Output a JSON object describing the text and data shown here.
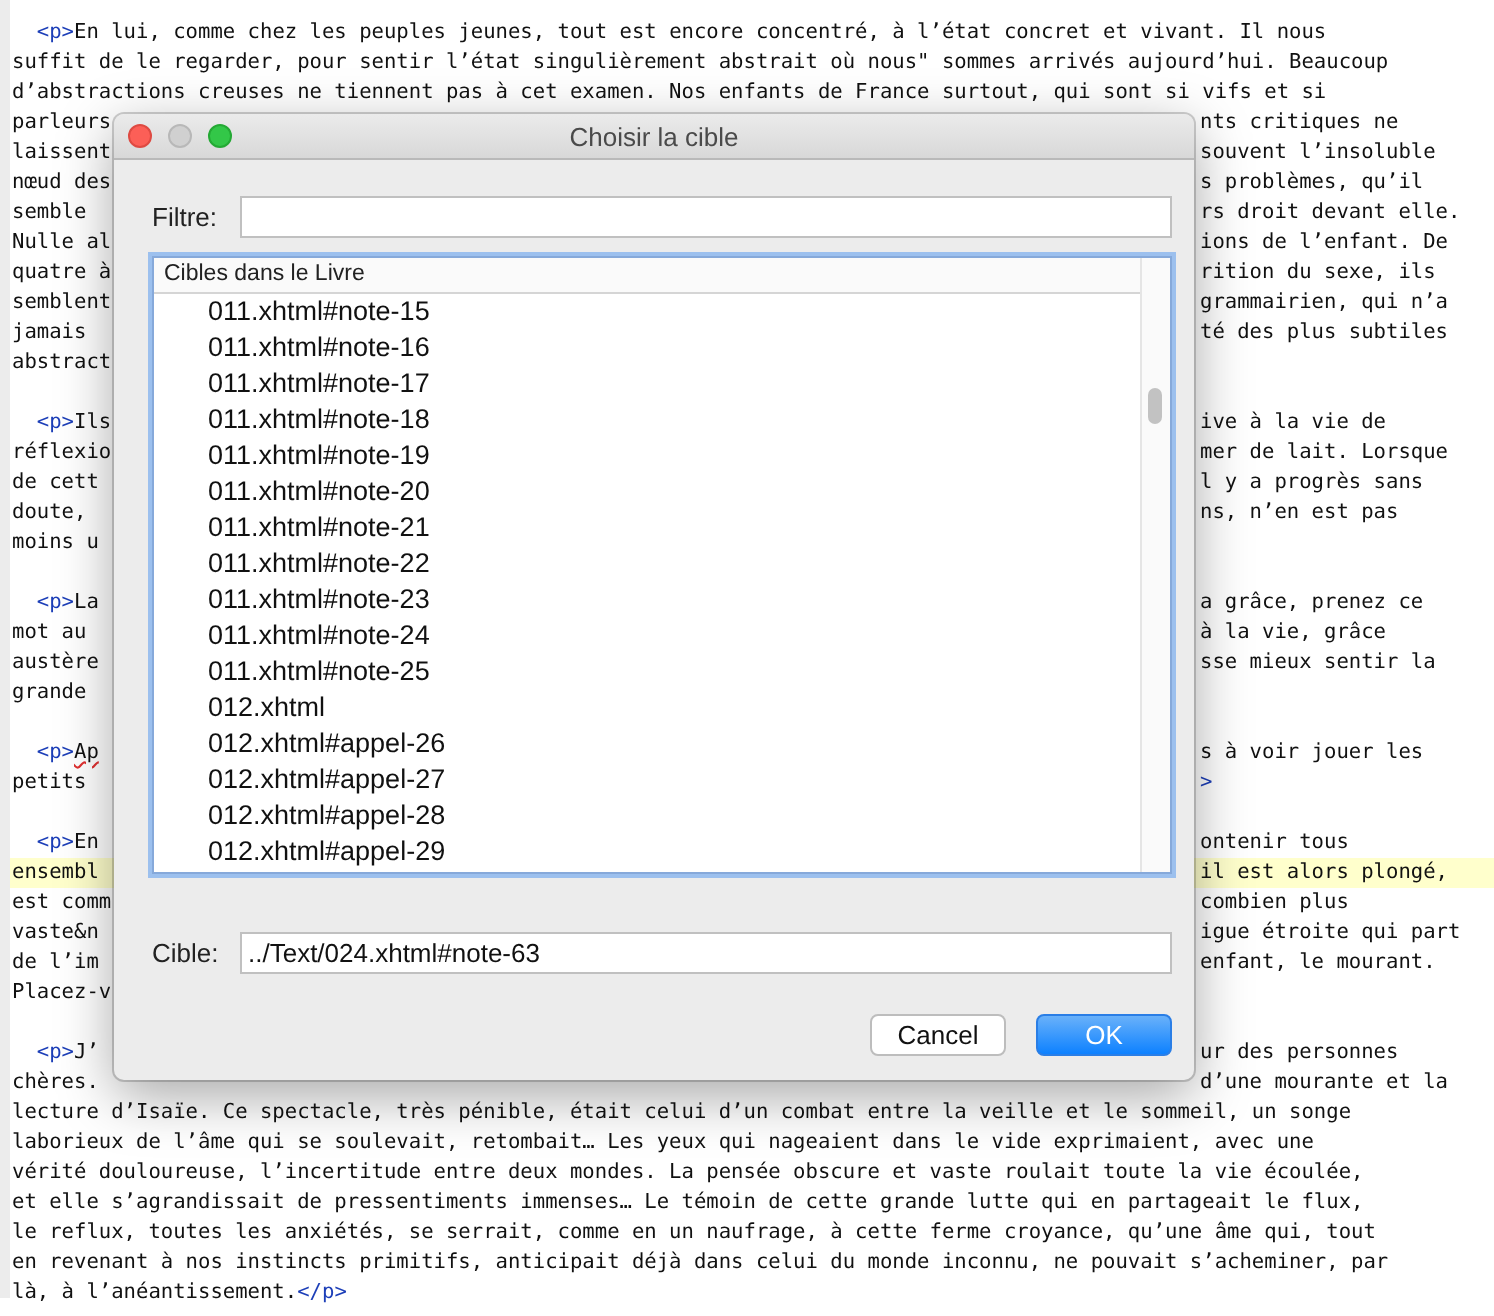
{
  "editor": {
    "paragraphs": [
      {
        "lines": [
          {
            "left": [
              {
                "kind": "tag",
                "text": "  <p>"
              },
              {
                "kind": "text",
                "text": "En lui, comme chez les peuples jeunes, tout est encore concentré, à l’état concret et vivant. Il nous"
              }
            ]
          },
          {
            "left": [
              {
                "kind": "text",
                "text": "suffit de le regarder, pour sentir l’état singulièrement abstrait où nous\" sommes arrivés aujourd’hui. Beaucoup"
              }
            ]
          },
          {
            "left": [
              {
                "kind": "text",
                "text": "d’abstractions creuses ne tiennent pas à cet examen. Nos enfants de France surtout, qui sont si vifs et si"
              }
            ]
          },
          {
            "left": [
              {
                "kind": "text",
                "text": "parleurs"
              }
            ],
            "right": [
              {
                "kind": "text",
                "text": "nts critiques ne"
              }
            ]
          },
          {
            "left": [
              {
                "kind": "text",
                "text": "laissent"
              }
            ],
            "right": [
              {
                "kind": "text",
                "text": "souvent l’insoluble"
              }
            ]
          },
          {
            "left": [
              {
                "kind": "text",
                "text": "nœud des"
              }
            ],
            "right": [
              {
                "kind": "text",
                "text": "s problèmes, qu’il"
              }
            ]
          },
          {
            "left": [
              {
                "kind": "text",
                "text": "semble"
              }
            ],
            "right": [
              {
                "kind": "text",
                "text": "rs droit devant elle."
              }
            ]
          },
          {
            "left": [
              {
                "kind": "text",
                "text": "Nulle al"
              }
            ],
            "right": [
              {
                "kind": "text",
                "text": "ions de l’enfant. De"
              }
            ]
          },
          {
            "left": [
              {
                "kind": "text",
                "text": "quatre à"
              }
            ],
            "right": [
              {
                "kind": "text",
                "text": "rition du sexe, ils"
              }
            ]
          },
          {
            "left": [
              {
                "kind": "text",
                "text": "semblent"
              }
            ],
            "right": [
              {
                "kind": "text",
                "text": "grammairien, qui n’a"
              }
            ]
          },
          {
            "left": [
              {
                "kind": "text",
                "text": "jamais"
              }
            ],
            "right": [
              {
                "kind": "text",
                "text": "té des plus subtiles"
              }
            ]
          },
          {
            "left": [
              {
                "kind": "text",
                "text": "abstract"
              }
            ]
          }
        ]
      },
      {
        "lines": [
          {
            "left": [
              {
                "kind": "tag",
                "text": "  <p>"
              },
              {
                "kind": "text",
                "text": "Ils"
              }
            ],
            "right": [
              {
                "kind": "text",
                "text": "ive à la vie de"
              }
            ]
          },
          {
            "left": [
              {
                "kind": "text",
                "text": "réflexio"
              }
            ],
            "right": [
              {
                "kind": "text",
                "text": "mer de lait. Lorsque"
              }
            ]
          },
          {
            "left": [
              {
                "kind": "text",
                "text": "de cett"
              }
            ],
            "right": [
              {
                "kind": "text",
                "text": "l y a progrès sans"
              }
            ]
          },
          {
            "left": [
              {
                "kind": "text",
                "text": "doute,"
              }
            ],
            "right": [
              {
                "kind": "text",
                "text": "ns, n’en est pas"
              }
            ]
          },
          {
            "left": [
              {
                "kind": "text",
                "text": "moins u"
              }
            ]
          }
        ]
      },
      {
        "lines": [
          {
            "left": [
              {
                "kind": "tag",
                "text": "  <p>"
              },
              {
                "kind": "text",
                "text": "La"
              }
            ],
            "right": [
              {
                "kind": "text",
                "text": "a grâce, prenez ce"
              }
            ]
          },
          {
            "left": [
              {
                "kind": "text",
                "text": "mot au"
              }
            ],
            "right": [
              {
                "kind": "text",
                "text": "à la vie, grâce"
              }
            ]
          },
          {
            "left": [
              {
                "kind": "text",
                "text": "austère"
              }
            ],
            "right": [
              {
                "kind": "text",
                "text": "sse mieux sentir la"
              }
            ]
          },
          {
            "left": [
              {
                "kind": "text",
                "text": "grande"
              }
            ]
          }
        ]
      },
      {
        "lines": [
          {
            "left": [
              {
                "kind": "tag",
                "text": "  <p>"
              },
              {
                "kind": "misspelled",
                "text": "Ap"
              }
            ],
            "right": [
              {
                "kind": "text",
                "text": "s à voir jouer les"
              }
            ]
          },
          {
            "left": [
              {
                "kind": "text",
                "text": "petits"
              }
            ],
            "right": [
              {
                "kind": "tag",
                "text": ">"
              }
            ]
          }
        ]
      },
      {
        "lines": [
          {
            "left": [
              {
                "kind": "tag",
                "text": "  <p>"
              },
              {
                "kind": "text",
                "text": "En"
              }
            ],
            "right": [
              {
                "kind": "text",
                "text": "ontenir tous"
              }
            ]
          },
          {
            "highlighted": true,
            "left": [
              {
                "kind": "text",
                "text": "ensembl"
              }
            ],
            "right": [
              {
                "kind": "text",
                "text": "il est alors plongé,"
              }
            ]
          },
          {
            "left": [
              {
                "kind": "text",
                "text": "est comm"
              }
            ],
            "right": [
              {
                "kind": "text",
                "text": "combien plus"
              }
            ]
          },
          {
            "left": [
              {
                "kind": "text",
                "text": "vaste&n"
              }
            ],
            "right": [
              {
                "kind": "text",
                "text": "igue étroite qui part"
              }
            ]
          },
          {
            "left": [
              {
                "kind": "text",
                "text": "de l’im"
              }
            ],
            "right": [
              {
                "kind": "text",
                "text": "enfant, le mourant."
              }
            ]
          },
          {
            "left": [
              {
                "kind": "text",
                "text": "Placez-v"
              }
            ]
          }
        ]
      },
      {
        "lines": [
          {
            "left": [
              {
                "kind": "tag",
                "text": "  <p>"
              },
              {
                "kind": "text",
                "text": "J’"
              }
            ],
            "right": [
              {
                "kind": "text",
                "text": "ur des personnes"
              }
            ]
          },
          {
            "left": [
              {
                "kind": "text",
                "text": "chères."
              }
            ],
            "right": [
              {
                "kind": "text",
                "text": "d’une mourante et la"
              }
            ]
          },
          {
            "left": [
              {
                "kind": "text",
                "text": "lecture d’Isaïe. Ce spectacle, très pénible, était celui d’un combat entre la veille et le sommeil, un songe"
              }
            ]
          },
          {
            "left": [
              {
                "kind": "text",
                "text": "laborieux de l’âme qui se soulevait, retombait… Les yeux qui nageaient dans le vide exprimaient, avec une"
              }
            ]
          },
          {
            "left": [
              {
                "kind": "text",
                "text": "vérité douloureuse, l’incertitude entre deux mondes. La pensée obscure et vaste roulait toute la vie écoulée,"
              }
            ]
          },
          {
            "left": [
              {
                "kind": "text",
                "text": "et elle s’agrandissait de pressentiments immenses… Le témoin de cette grande lutte qui en partageait le flux,"
              }
            ]
          },
          {
            "left": [
              {
                "kind": "text",
                "text": "le reflux, toutes les anxiétés, se serrait, comme en un naufrage, à cette ferme croyance, qu’une âme qui, tout"
              }
            ]
          },
          {
            "left": [
              {
                "kind": "text",
                "text": "en revenant à nos instincts primitifs, anticipait déjà dans celui du monde inconnu, ne pouvait s’acheminer, par"
              }
            ]
          },
          {
            "left": [
              {
                "kind": "text",
                "text": "là, à l’anéantissement."
              },
              {
                "kind": "tag",
                "text": "</p>"
              }
            ]
          }
        ]
      }
    ]
  },
  "dialog": {
    "title": "Choisir la cible",
    "window_controls": [
      {
        "kind": "close",
        "disabled": false
      },
      {
        "kind": "minimize",
        "disabled": true
      },
      {
        "kind": "zoom",
        "disabled": false
      }
    ],
    "filter": {
      "label": "Filtre:"
    },
    "list": {
      "header": "Cibles dans le Livre",
      "items": [
        {
          "label": "011.xhtml#note-15",
          "selected": false
        },
        {
          "label": "011.xhtml#note-16",
          "selected": false
        },
        {
          "label": "011.xhtml#note-17",
          "selected": false
        },
        {
          "label": "011.xhtml#note-18",
          "selected": false
        },
        {
          "label": "011.xhtml#note-19",
          "selected": false
        },
        {
          "label": "011.xhtml#note-20",
          "selected": false
        },
        {
          "label": "011.xhtml#note-21",
          "selected": false
        },
        {
          "label": "011.xhtml#note-22",
          "selected": false
        },
        {
          "label": "011.xhtml#note-23",
          "selected": false
        },
        {
          "label": "011.xhtml#note-24",
          "selected": false
        },
        {
          "label": "011.xhtml#note-25",
          "selected": false
        },
        {
          "label": "012.xhtml",
          "selected": false
        },
        {
          "label": "012.xhtml#appel-26",
          "selected": false
        },
        {
          "label": "012.xhtml#appel-27",
          "selected": false
        },
        {
          "label": "012.xhtml#appel-28",
          "selected": false
        },
        {
          "label": "012.xhtml#appel-29",
          "selected": false
        }
      ]
    },
    "target": {
      "label": "Cible:",
      "value": "../Text/024.xhtml#note-63"
    },
    "buttons": [
      {
        "label": "Cancel",
        "default": false
      },
      {
        "label": "OK",
        "default": true
      }
    ]
  }
}
